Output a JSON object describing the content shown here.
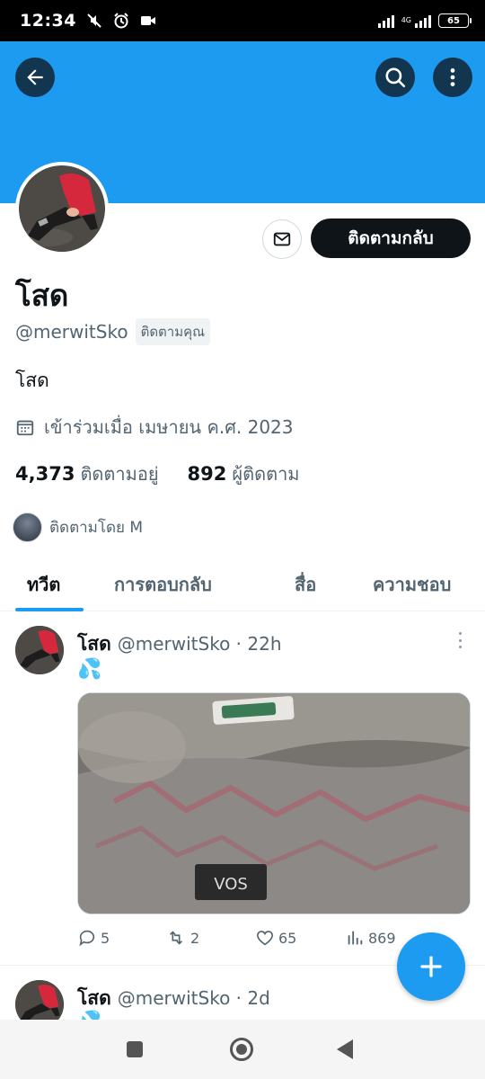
{
  "status_bar": {
    "time": "12:34",
    "network": "4G",
    "battery": "65"
  },
  "header": {
    "back_icon": "arrow-left-icon",
    "search_icon": "search-icon",
    "more_icon": "more-vertical-icon",
    "banner_color": "#1d9bf0"
  },
  "profile": {
    "message_icon": "mail-icon",
    "follow_back_label": "ติดตามกลับ",
    "display_name": "โสด",
    "handle": "@merwitSko",
    "follows_you_badge": "ติดตามคุณ",
    "bio": "โสด",
    "joined_icon": "calendar-icon",
    "joined": "เข้าร่วมเมื่อ เมษายน ค.ศ. 2023",
    "following_count": "4,373",
    "following_label": "ติดตามอยู่",
    "followers_count": "892",
    "followers_label": "ผู้ติดตาม",
    "followed_by": "ติดตามโดย M"
  },
  "tabs": [
    {
      "label": "ทวีต",
      "active": true
    },
    {
      "label": "การตอบกลับ",
      "active": false
    },
    {
      "label": "สื่อ",
      "active": false
    },
    {
      "label": "ความชอบ",
      "active": false
    }
  ],
  "tweets": [
    {
      "name": "โสด",
      "handle_time": "@merwitSko · 22h",
      "text": "💦",
      "replies": "5",
      "retweets": "2",
      "likes": "65",
      "views": "869"
    },
    {
      "name": "โสด",
      "handle_time": "@merwitSko · 2d",
      "text": "💦"
    }
  ],
  "fab": {
    "icon": "plus-icon",
    "color": "#1d9bf0"
  },
  "nav": {
    "recents_icon": "square-icon",
    "home_icon": "circle-icon",
    "back_icon": "triangle-back-icon"
  }
}
